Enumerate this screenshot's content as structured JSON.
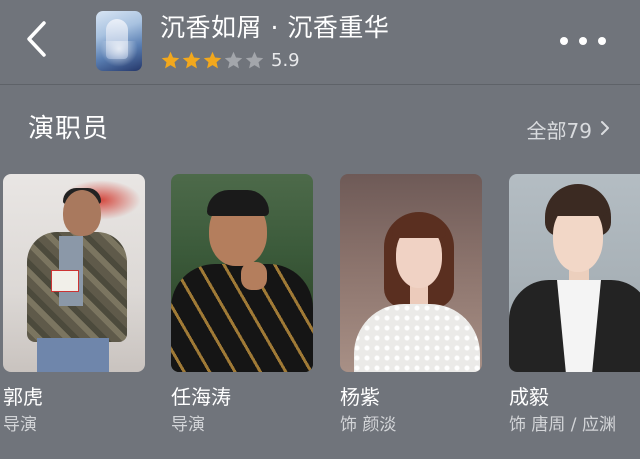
{
  "header": {
    "title": "沉香如屑 · 沉香重华",
    "rating": {
      "score": "5.9",
      "stars_filled": 3,
      "stars_total": 5
    }
  },
  "cast_section": {
    "title": "演职员",
    "see_all_label": "全部79"
  },
  "cast": [
    {
      "name": "郭虎",
      "role": "导演"
    },
    {
      "name": "任海涛",
      "role": "导演"
    },
    {
      "name": "杨紫",
      "role": "饰 颜淡"
    },
    {
      "name": "成毅",
      "role": "饰 唐周 / 应渊"
    }
  ],
  "icons": {
    "back": "chevron-left-icon",
    "more": "more-dots-icon",
    "see_all": "chevron-right-icon",
    "star": "star-icon"
  },
  "colors": {
    "background": "#70747b",
    "star_filled": "#f2a81d",
    "star_empty": "#a3a6ab",
    "text_primary": "#ffffff",
    "text_secondary": "#d3d5d8"
  }
}
